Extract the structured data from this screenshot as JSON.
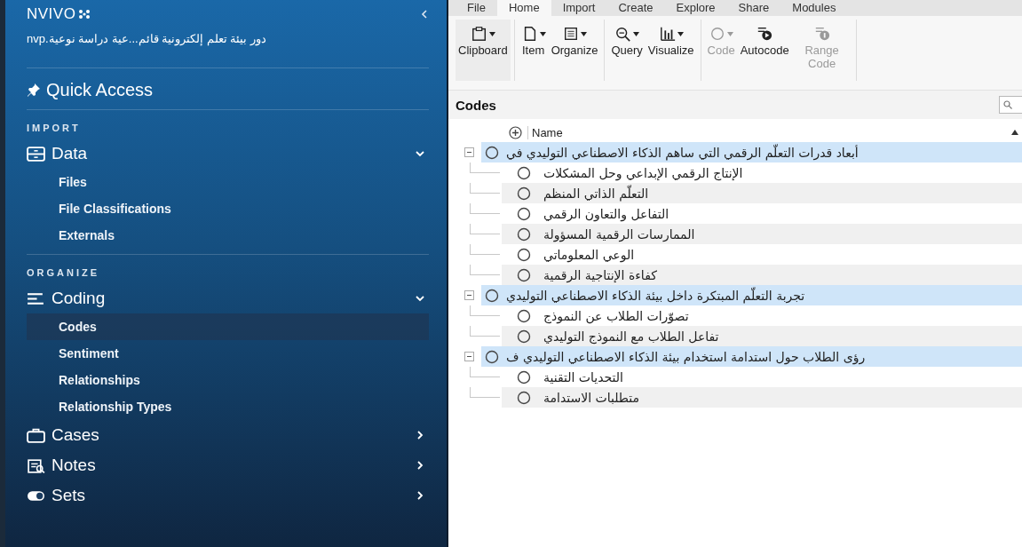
{
  "sidebar": {
    "logo": "NVIVO",
    "project": "دور بيئة تعلم إلكترونية قائم...عية دراسة نوعية.nvp",
    "quick_access": "Quick Access",
    "sections": [
      {
        "title": "IMPORT",
        "groups": [
          {
            "kind": "data",
            "label": "Data",
            "expanded": true,
            "items": [
              {
                "label": "Files",
                "selected": false
              },
              {
                "label": "File Classifications",
                "selected": false
              },
              {
                "label": "Externals",
                "selected": false
              }
            ]
          }
        ]
      },
      {
        "title": "ORGANIZE",
        "groups": [
          {
            "kind": "coding",
            "label": "Coding",
            "expanded": true,
            "items": [
              {
                "label": "Codes",
                "selected": true
              },
              {
                "label": "Sentiment",
                "selected": false
              },
              {
                "label": "Relationships",
                "selected": false
              },
              {
                "label": "Relationship Types",
                "selected": false
              }
            ]
          },
          {
            "kind": "cases",
            "label": "Cases",
            "expanded": false
          },
          {
            "kind": "notes",
            "label": "Notes",
            "expanded": false
          },
          {
            "kind": "sets",
            "label": "Sets",
            "expanded": false
          }
        ]
      }
    ]
  },
  "tabs": [
    {
      "label": "File",
      "selected": false
    },
    {
      "label": "Home",
      "selected": true
    },
    {
      "label": "Import",
      "selected": false
    },
    {
      "label": "Create",
      "selected": false
    },
    {
      "label": "Explore",
      "selected": false
    },
    {
      "label": "Share",
      "selected": false
    },
    {
      "label": "Modules",
      "selected": false
    }
  ],
  "ribbon": [
    [
      {
        "kind": "clipboard",
        "label": "Clipboard",
        "menu": true,
        "disabled": false
      }
    ],
    [
      {
        "kind": "item",
        "label": "Item",
        "menu": true,
        "disabled": false
      },
      {
        "kind": "organize",
        "label": "Organize",
        "menu": true,
        "disabled": false
      }
    ],
    [
      {
        "kind": "query",
        "label": "Query",
        "menu": true,
        "disabled": false
      },
      {
        "kind": "visualize",
        "label": "Visualize",
        "menu": true,
        "disabled": false
      }
    ],
    [
      {
        "kind": "code",
        "label": "Code",
        "menu": true,
        "disabled": true
      },
      {
        "kind": "autocode",
        "label": "Autocode",
        "menu": false,
        "disabled": false
      },
      {
        "kind": "rangecode",
        "label": "Range Code",
        "menu": false,
        "disabled": true
      }
    ]
  ],
  "codes": {
    "title": "Codes",
    "columns": [
      "Name"
    ],
    "nodes": [
      {
        "name": "أبعاد قدرات التعلّم الرقمي التي ساهم الذكاء الاصطناعي التوليدي في",
        "selected": true,
        "expanded": true,
        "children": [
          {
            "name": "الإنتاج الرقمي الإبداعي وحل المشكلات",
            "selected": false
          },
          {
            "name": "التعلّم الذاتي المنظم",
            "selected": false
          },
          {
            "name": "التفاعل والتعاون الرقمي",
            "selected": false
          },
          {
            "name": "الممارسات الرقمية المسؤولة",
            "selected": false
          },
          {
            "name": "الوعي المعلوماتي",
            "selected": false
          },
          {
            "name": "كفاءة الإنتاجية الرقمية",
            "selected": false
          }
        ]
      },
      {
        "name": "تجربة التعلّم المبتكرة داخل بيئة الذكاء الاصطناعي التوليدي",
        "selected": true,
        "expanded": true,
        "children": [
          {
            "name": "تصوّرات الطلاب عن النموذج",
            "selected": false
          },
          {
            "name": "تفاعل الطلاب مع النموذج التوليدي",
            "selected": false
          }
        ]
      },
      {
        "name": "رؤى الطلاب حول استدامة استخدام بيئة الذكاء الاصطناعي التوليدي ف",
        "selected": true,
        "expanded": true,
        "children": [
          {
            "name": "التحديات التقنية",
            "selected": false
          },
          {
            "name": "متطلبات الاستدامة",
            "selected": false
          }
        ]
      }
    ]
  }
}
